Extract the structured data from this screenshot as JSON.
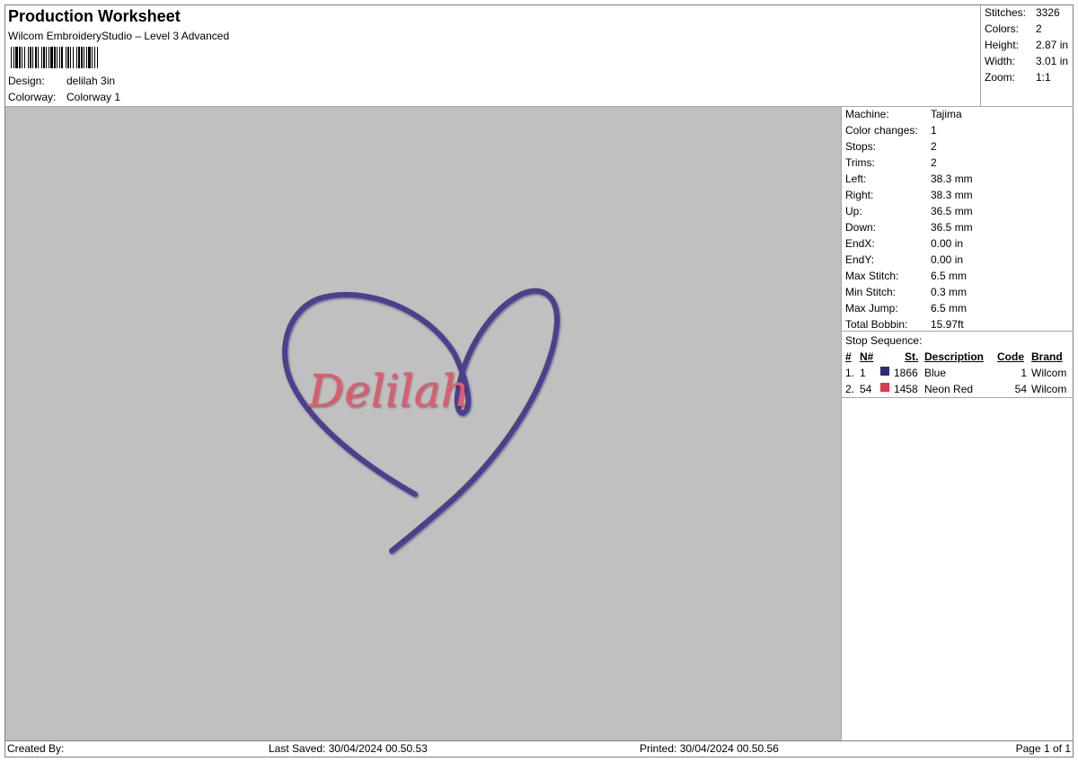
{
  "header": {
    "title": "Production Worksheet",
    "subtitle": "Wilcom EmbroideryStudio – Level 3 Advanced",
    "design_label": "Design:",
    "design_value": "delilah 3in",
    "colorway_label": "Colorway:",
    "colorway_value": "Colorway 1"
  },
  "stats": [
    {
      "label": "Stitches:",
      "value": "3326"
    },
    {
      "label": "Colors:",
      "value": "2"
    },
    {
      "label": "Height:",
      "value": "2.87 in"
    },
    {
      "label": "Width:",
      "value": "3.01 in"
    },
    {
      "label": "Zoom:",
      "value": "1:1"
    }
  ],
  "machine": [
    {
      "label": "Machine:",
      "value": "Tajima"
    },
    {
      "label": "Color changes:",
      "value": "1"
    },
    {
      "label": "Stops:",
      "value": "2"
    },
    {
      "label": "Trims:",
      "value": "2"
    },
    {
      "label": "Left:",
      "value": "38.3 mm"
    },
    {
      "label": "Right:",
      "value": "38.3 mm"
    },
    {
      "label": "Up:",
      "value": "36.5 mm"
    },
    {
      "label": "Down:",
      "value": "36.5 mm"
    },
    {
      "label": "EndX:",
      "value": "0.00 in"
    },
    {
      "label": "EndY:",
      "value": "0.00 in"
    },
    {
      "label": "Max Stitch:",
      "value": "6.5 mm"
    },
    {
      "label": "Min Stitch:",
      "value": "0.3 mm"
    },
    {
      "label": "Max Jump:",
      "value": "6.5 mm"
    },
    {
      "label": "Total Bobbin:",
      "value": "15.97ft"
    }
  ],
  "stop_sequence": {
    "title": "Stop Sequence:",
    "headers": {
      "num": "#",
      "needle": "N#",
      "stitches": "St.",
      "description": "Description",
      "code": "Code",
      "brand": "Brand"
    },
    "rows": [
      {
        "num": "1.",
        "needle": "1",
        "color": "#2e2a7a",
        "stitches": "1866",
        "description": "Blue",
        "code": "1",
        "brand": "Wilcom"
      },
      {
        "num": "2.",
        "needle": "54",
        "color": "#e0364f",
        "stitches": "1458",
        "description": "Neon Red",
        "code": "54",
        "brand": "Wilcom"
      }
    ]
  },
  "design_preview": {
    "text": "Delilah",
    "heart_color": "#4a3f8f",
    "text_color": "#e25a6e",
    "background": "#c0c0c0"
  },
  "footer": {
    "created_by": "Created By:",
    "last_saved": "Last Saved: 30/04/2024 00.50.53",
    "printed": "Printed: 30/04/2024 00.50.56",
    "page": "Page 1 of 1"
  }
}
